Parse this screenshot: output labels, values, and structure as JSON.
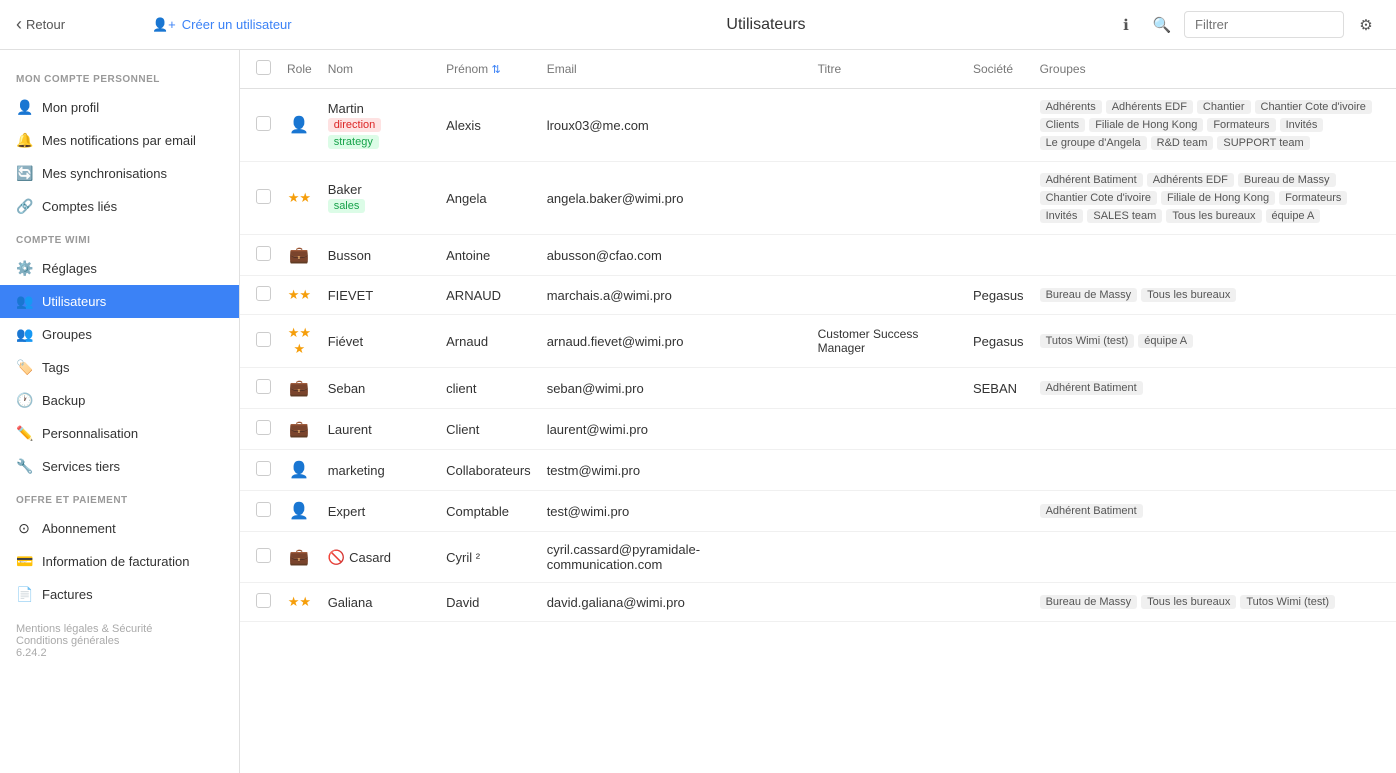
{
  "topbar": {
    "back_label": "Retour",
    "create_label": "Créer un utilisateur",
    "title": "Utilisateurs",
    "filter_placeholder": "Filtrer"
  },
  "sidebar": {
    "section_personal": "MON COMPTE PERSONNEL",
    "section_wimi": "COMPTE WIMI",
    "section_payment": "OFFRE ET PAIEMENT",
    "items_personal": [
      {
        "id": "mon-profil",
        "label": "Mon profil",
        "icon": "👤"
      },
      {
        "id": "notifications",
        "label": "Mes notifications par email",
        "icon": "🔔"
      },
      {
        "id": "synchronisations",
        "label": "Mes synchronisations",
        "icon": "🔄"
      },
      {
        "id": "comptes-lies",
        "label": "Comptes liés",
        "icon": "🔗"
      }
    ],
    "items_wimi": [
      {
        "id": "reglages",
        "label": "Réglages",
        "icon": "⚙️"
      },
      {
        "id": "utilisateurs",
        "label": "Utilisateurs",
        "icon": "👥",
        "active": true
      },
      {
        "id": "groupes",
        "label": "Groupes",
        "icon": "👥"
      },
      {
        "id": "tags",
        "label": "Tags",
        "icon": "🏷️"
      },
      {
        "id": "backup",
        "label": "Backup",
        "icon": "🕐"
      },
      {
        "id": "personnalisation",
        "label": "Personnalisation",
        "icon": "✏️"
      },
      {
        "id": "services-tiers",
        "label": "Services tiers",
        "icon": "🔧"
      }
    ],
    "items_payment": [
      {
        "id": "abonnement",
        "label": "Abonnement",
        "icon": "⊙"
      },
      {
        "id": "facturation",
        "label": "Information de facturation",
        "icon": "💳"
      },
      {
        "id": "factures",
        "label": "Factures",
        "icon": "📄"
      }
    ],
    "footer_legal": "Mentions légales & Sécurité",
    "footer_cg": "Conditions générales",
    "version": "6.24.2"
  },
  "table": {
    "columns": [
      "",
      "Role",
      "Nom",
      "Prénom",
      "Email",
      "Titre",
      "Société",
      "Groupes"
    ],
    "rows": [
      {
        "role_type": "person",
        "role_stars": "",
        "nom": "Martin",
        "nom_tags": [
          {
            "label": "direction",
            "color": "red"
          },
          {
            "label": "strategy",
            "color": "green"
          }
        ],
        "prenom": "Alexis",
        "email": "lroux03@me.com",
        "titre": "",
        "societe": "",
        "groups": [
          "Adhérents",
          "Adhérents EDF",
          "Chantier",
          "Chantier Cote d'ivoire",
          "Clients",
          "Filiale de Hong Kong",
          "Formateurs",
          "Invités",
          "Le groupe d'Angela",
          "R&D team",
          "SUPPORT team"
        ]
      },
      {
        "role_type": "stars2",
        "role_stars": "★★",
        "nom": "Baker",
        "nom_tags": [
          {
            "label": "sales",
            "color": "green"
          }
        ],
        "prenom": "Angela",
        "email": "angela.baker@wimi.pro",
        "titre": "",
        "societe": "",
        "groups": [
          "Adhérent Batiment",
          "Adhérents EDF",
          "Bureau de Massy",
          "Chantier Cote d'ivoire",
          "Filiale de Hong Kong",
          "Formateurs",
          "Invités",
          "SALES team",
          "Tous les bureaux",
          "équipe A"
        ]
      },
      {
        "role_type": "briefcase",
        "role_stars": "",
        "nom": "Busson",
        "nom_tags": [],
        "prenom": "Antoine",
        "email": "abusson@cfao.com",
        "titre": "",
        "societe": "",
        "groups": []
      },
      {
        "role_type": "stars2",
        "role_stars": "★★",
        "nom": "FIEVET",
        "nom_tags": [],
        "prenom": "ARNAUD",
        "email": "marchais.a@wimi.pro",
        "titre": "",
        "societe": "Pegasus",
        "groups": [
          "Bureau de Massy",
          "Tous les bureaux"
        ]
      },
      {
        "role_type": "stars3",
        "role_stars": "★★★",
        "nom": "Fiévet",
        "nom_tags": [],
        "prenom": "Arnaud",
        "email": "arnaud.fievet@wimi.pro",
        "titre": "Customer Success Manager",
        "societe": "Pegasus",
        "groups": [
          "Tutos Wimi (test)",
          "équipe A"
        ]
      },
      {
        "role_type": "briefcase",
        "role_stars": "",
        "nom": "Seban",
        "nom_tags": [],
        "prenom": "client",
        "email": "seban@wimi.pro",
        "titre": "",
        "societe": "SEBAN",
        "groups": [
          "Adhérent Batiment"
        ]
      },
      {
        "role_type": "briefcase",
        "role_stars": "",
        "nom": "Laurent",
        "nom_tags": [],
        "prenom": "Client",
        "email": "laurent@wimi.pro",
        "titre": "",
        "societe": "",
        "groups": []
      },
      {
        "role_type": "person",
        "role_stars": "",
        "nom": "marketing",
        "nom_tags": [],
        "prenom": "Collaborateurs",
        "email": "testm@wimi.pro",
        "titre": "",
        "societe": "",
        "groups": []
      },
      {
        "role_type": "person",
        "role_stars": "",
        "nom": "Expert",
        "nom_tags": [],
        "prenom": "Comptable",
        "email": "test@wimi.pro",
        "titre": "",
        "societe": "",
        "groups": [
          "Adhérent Batiment"
        ]
      },
      {
        "role_type": "briefcase",
        "role_stars": "",
        "nom": "Casard",
        "nom_tags": [],
        "blocked": true,
        "prenom": "Cyril ²",
        "email": "cyril.cassard@pyramidale-communication.com",
        "titre": "",
        "societe": "",
        "groups": []
      },
      {
        "role_type": "stars2",
        "role_stars": "★★",
        "nom": "Galiana",
        "nom_tags": [],
        "prenom": "David",
        "email": "david.galiana@wimi.pro",
        "titre": "",
        "societe": "",
        "groups": [
          "Bureau de Massy",
          "Tous les bureaux",
          "Tutos Wimi (test)"
        ]
      }
    ]
  }
}
